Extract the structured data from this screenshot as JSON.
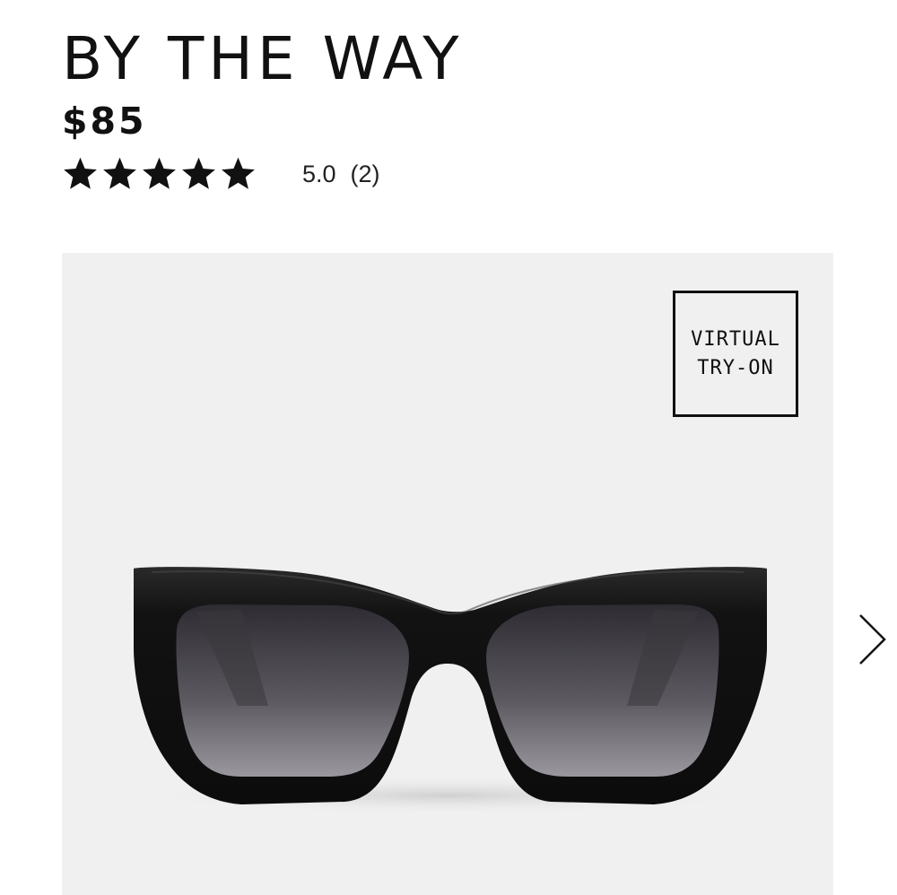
{
  "product": {
    "name": "BY THE WAY",
    "price": "$85",
    "rating": {
      "stars_filled": 5,
      "stars_total": 5,
      "score": "5.0",
      "count": "(2)"
    }
  },
  "gallery": {
    "virtual_try_on": {
      "line1": "VIRTUAL",
      "line2": "TRY-ON"
    },
    "image_alt": "black cat-eye sunglasses with gradient lenses",
    "next_icon": "chevron-right-icon"
  },
  "colors": {
    "text": "#111111",
    "gallery_bg": "#f0f0f0",
    "frame": "#141414",
    "lens_top": "#2e2c32",
    "lens_bottom": "#9b979e"
  }
}
